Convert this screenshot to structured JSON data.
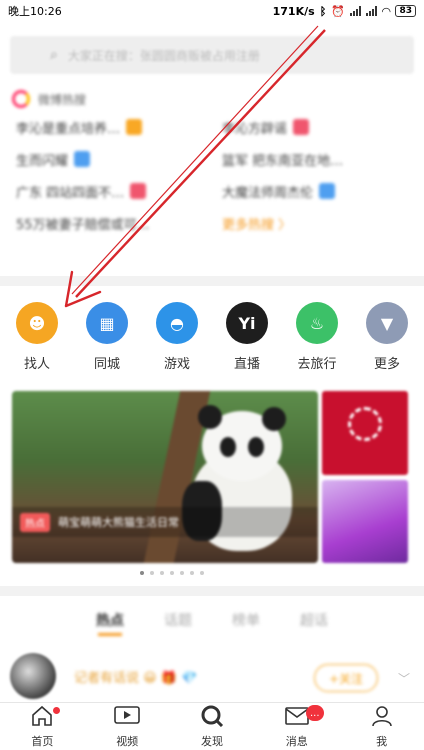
{
  "status_bar": {
    "time": "晚上10:26",
    "net_speed": "171K/s",
    "battery": "83"
  },
  "search": {
    "placeholder": "大家正在搜：张圆圆商贩被占用注册"
  },
  "hot": {
    "title": "微博热搜",
    "items": [
      {
        "text": "李沁是重点培养…",
        "tag": "orange"
      },
      {
        "text": "李沁方辟谣",
        "tag": "red"
      },
      {
        "text": "生而闪耀",
        "tag": "blue"
      },
      {
        "text": "篮军 把东南亚在地…",
        "tag": "none"
      },
      {
        "text": "广东 四站四面不…",
        "tag": "red"
      },
      {
        "text": "大魔法师周杰伦",
        "tag": "blue"
      },
      {
        "text": "55万被妻子赔偿或可…",
        "tag": "none"
      },
      {
        "text": "更多热搜 〉",
        "tag": "more"
      }
    ]
  },
  "quick_links": [
    {
      "label": "找人",
      "icon": "find-people-icon",
      "color": "#f5a623",
      "glyph": "☻"
    },
    {
      "label": "同城",
      "icon": "city-building-icon",
      "color": "#3a8ee6",
      "glyph": "▦"
    },
    {
      "label": "游戏",
      "icon": "game-ghost-icon",
      "color": "#2d93e8",
      "glyph": "◓"
    },
    {
      "label": "直播",
      "icon": "live-yi-icon",
      "color": "#1e1e1e",
      "glyph": "Yi"
    },
    {
      "label": "去旅行",
      "icon": "balloon-travel-icon",
      "color": "#3cc168",
      "glyph": "♨"
    },
    {
      "label": "更多",
      "icon": "more-arrow-icon",
      "color": "#8e9bb5",
      "glyph": "▼"
    }
  ],
  "banner": {
    "tag": "热点",
    "caption": "萌宝萌萌大熊猫生活日常"
  },
  "feed_tabs": [
    "热点",
    "话题",
    "榜单",
    "超话"
  ],
  "post": {
    "text": "记者有话说 😀 🎁 💎",
    "follow": "+关注"
  },
  "bottom_nav": [
    {
      "label": "首页",
      "icon": "home-icon",
      "dot": true,
      "badge": ""
    },
    {
      "label": "视频",
      "icon": "video-icon",
      "dot": false,
      "badge": ""
    },
    {
      "label": "发现",
      "icon": "discover-search-icon",
      "dot": false,
      "badge": ""
    },
    {
      "label": "消息",
      "icon": "message-mail-icon",
      "dot": false,
      "badge": "..."
    },
    {
      "label": "我",
      "icon": "profile-icon",
      "dot": false,
      "badge": ""
    }
  ],
  "colors": {
    "accent": "#f59b23",
    "annotation": "#d7262b"
  }
}
